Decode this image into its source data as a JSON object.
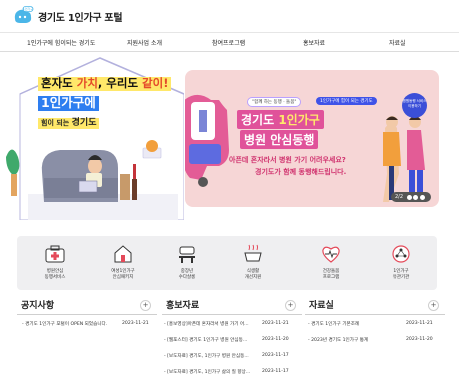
{
  "header": {
    "site_title": "경기도 1인가구 포털",
    "logo_badge": "1인가구"
  },
  "nav": {
    "items": [
      "1인가구에 힘이되는 경기도",
      "지원사업 소개",
      "참여프로그램",
      "홍보자료",
      "자료실"
    ]
  },
  "hero_left": {
    "line1_a": "혼자도 ",
    "line1_b": "가치",
    "line1_c": ", 우리도 ",
    "line1_d": "같이!",
    "line2": "1인가구에",
    "line3_a": "힘이 되는 ",
    "line3_b": "경기도"
  },
  "banner": {
    "pill_a": "\"함께 하는 동행 · 돌봄\"",
    "pill_b": "1인가구에 힘이 되는 경기도",
    "title_a1": "경기도 ",
    "title_a2": "1인가구",
    "title_b": "병원 안심동행",
    "sub1": "아픈데 혼자라서 병원 가기 어려우세요?",
    "sub2": "경기도가 함께 동행해드립니다.",
    "badge": "병원동행 서비스 이용하기",
    "pager": "2/2"
  },
  "services": [
    {
      "label1": "병원안심",
      "label2": "동행서비스",
      "icon": "medical-kit-icon"
    },
    {
      "label1": "여성1인가구",
      "label2": "안심패키지",
      "icon": "safe-house-icon"
    },
    {
      "label1": "중장년",
      "label2": "수다살롱",
      "icon": "chat-table-icon"
    },
    {
      "label1": "식생활",
      "label2": "개선지원",
      "icon": "cooking-pot-icon"
    },
    {
      "label1": "건강돌봄",
      "label2": "프로그램",
      "icon": "heart-pulse-icon"
    },
    {
      "label1": "1인가구",
      "label2": "유관기관",
      "icon": "network-icon"
    }
  ],
  "boards": {
    "notice": {
      "title": "공지사항",
      "posts": [
        {
          "text": "- 경기도 1인가구 포털이 OPEN 되었습니다.",
          "date": "2023-11-21"
        }
      ]
    },
    "promo": {
      "title": "홍보자료",
      "posts": [
        {
          "text": "- [홍보영상]아픈데 혼자라서 병원 가기 어...",
          "date": "2023-11-21"
        },
        {
          "text": "- [웹포스터] 경기도 1인가구 병원 안심동...",
          "date": "2023-11-20"
        },
        {
          "text": "- [보도자료] 경기도, 1인가구 병원 안심동...",
          "date": "2023-11-17"
        },
        {
          "text": "- [보도자료] 경기도, 1인가구 삶의 질 향상...",
          "date": "2023-11-17"
        }
      ]
    },
    "archive": {
      "title": "자료실",
      "posts": [
        {
          "text": "- 경기도 1인가구 기본조례",
          "date": "2023-11-21"
        },
        {
          "text": "- 2023년 경기도 1인가구 통계",
          "date": "2023-11-20"
        }
      ]
    }
  },
  "colors": {
    "accent_blue": "#2e7ef0",
    "highlight_yellow": "#ffe86a",
    "banner_pink": "#e0529a",
    "banner_bg": "#f6d6d6"
  }
}
